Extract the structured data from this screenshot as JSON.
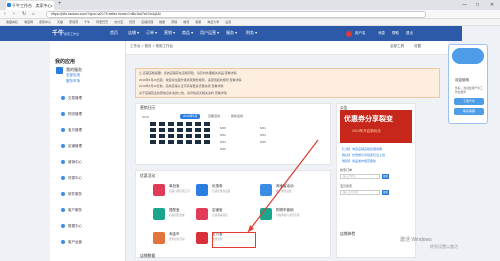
{
  "browser": {
    "tab_title": "千牛工作台 - 卖家中心",
    "new_tab": "+",
    "url": "https://pifu.taobao.com/?spm=a217h.seller.home.0.d8c1bd7a10nJq2&t",
    "win_min": "—",
    "win_max": "□",
    "win_close": "✕",
    "back": "‹",
    "forward": "›",
    "reload": "↻",
    "home": "⌂",
    "bookmarks": [
      "收藏夹栏",
      "淘宝网",
      "卖家中心",
      "天猫",
      "聚划算",
      "千牛",
      "阿里巴巴",
      "支付宝",
      "旺旺",
      "店铺管理",
      "数据",
      "营销",
      "物流",
      "客服",
      "淘宝大学",
      "设置"
    ]
  },
  "app": {
    "logo": "千牛",
    "logo_sub": "卖家工作台",
    "menu": [
      "首页",
      "店铺 ▾",
      "订单 ▾",
      "营销 ▾",
      "商品 ▾",
      "用户运营 ▾",
      "服务 ▾",
      "财务 ▾"
    ],
    "right_links": [
      "消息",
      "帮助",
      "退出"
    ],
    "user_name": "用户名"
  },
  "floating": {
    "title": "欢迎使用",
    "desc": "您好，欢迎使用千牛工作台服务",
    "btn1": "下载千牛",
    "btn2": "联系客服"
  },
  "sidebar": {
    "title": "我的应用",
    "section": "我的服务",
    "links": [
      "全部应用",
      "服务市场"
    ],
    "items": [
      "交易管理",
      "物流管理",
      "宝贝管理",
      "店铺管理",
      "营销中心",
      "货源中心",
      "软件服务",
      "客户服务",
      "数据中心",
      "客户运营"
    ]
  },
  "breadcrumb": {
    "path": "工作台 > 首页 > 常用工作台",
    "right": [
      "全部工具",
      "设置"
    ]
  },
  "notice": {
    "lines": [
      "⚠ 店铺违规提醒：您的店铺存在违规风险，请及时处理相关商品  查看详情",
      "2019年5月20日起，淘宝将全面升级商家服务规则，请查阅最新规则  查看详情",
      "2019年5月30日前，完成店铺认证可获得更多流量扶持  查看详情",
      "关于店铺营业执照信息补充的公告，请尽快完善相关资料  查看详情"
    ]
  },
  "calendar": {
    "title": "营销日历",
    "year": "2019",
    "tab_active": "2019年5月",
    "tab2": "近期活动",
    "tab3": "我的活动",
    "dates": [
      "5/20",
      "5/21",
      "5/22",
      "5/23",
      "5/24",
      "5/25",
      "5/26"
    ]
  },
  "services": {
    "title": "优惠活动",
    "items": [
      {
        "name": "单品宝",
        "desc": "商品打折促销工具"
      },
      {
        "name": "优惠券",
        "desc": "店铺优惠券设置"
      },
      {
        "name": "搭配宝",
        "desc": "商品搭配套餐"
      },
      {
        "name": "店铺宝",
        "desc": "店铺满减满送"
      },
      {
        "name": "淘金币",
        "desc": "金币抵扣活动"
      },
      {
        "name": "支付宝",
        "desc": "收款管理"
      },
      {
        "name": "淘宝客活动",
        "desc": "推广佣金设置"
      },
      {
        "name": "购物车营销",
        "desc": "对加购用户进行营销"
      }
    ]
  },
  "right_panel": {
    "title": "公告",
    "promo_title": "优惠券分享裂变",
    "promo_sub": "2019年开启新玩法",
    "links": [
      "【公告】淘宝店铺违规处理说明",
      "【热点】优惠券分享裂变玩法上线",
      "【规则】商品发布规范更新"
    ],
    "search_title": "搜索订单",
    "search_placeholder": "输入订单号",
    "search_btn": "搜索",
    "search2_title": "宝贝搜索",
    "search2_placeholder": "输入宝贝名称",
    "bottom_title": "店铺体检"
  },
  "bottom_left_title": "店铺数据",
  "watermark": {
    "line1": "激活 Windows",
    "line2": "转到设置以激活"
  },
  "colors": {
    "header": "#2c5aa8",
    "notice_bg": "#fdeee0",
    "promo": "#c7261a",
    "highlight": "#e23b30"
  }
}
